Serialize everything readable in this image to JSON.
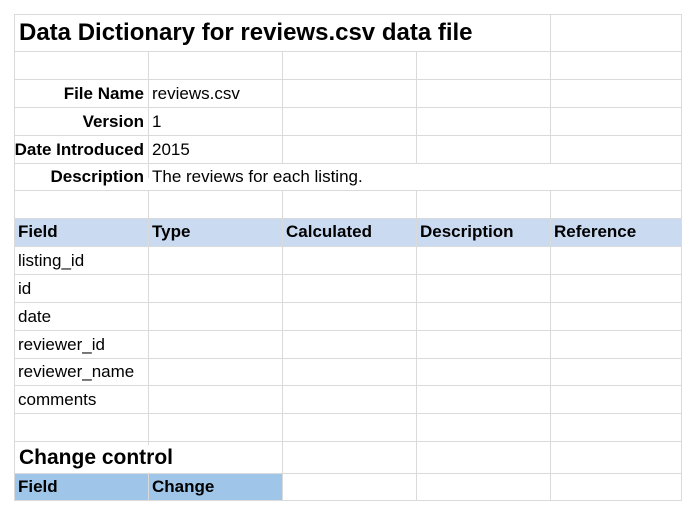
{
  "title": "Data Dictionary for reviews.csv data file",
  "meta": [
    {
      "label": "File Name",
      "value": "reviews.csv"
    },
    {
      "label": "Version",
      "value": "1"
    },
    {
      "label": "Date Introduced",
      "value": "2015"
    },
    {
      "label": "Description",
      "value": "The reviews for each listing."
    }
  ],
  "fields_table": {
    "headers": [
      "Field",
      "Type",
      "Calculated",
      "Description",
      "Reference"
    ],
    "rows": [
      "listing_id",
      "id",
      "date",
      "reviewer_id",
      "reviewer_name",
      "comments"
    ]
  },
  "change_control": {
    "title": "Change control",
    "headers": [
      "Field",
      "Change"
    ]
  },
  "colors": {
    "header_fill": "#c9daf1",
    "change_header_fill": "#9fc5e8",
    "grid": "#dadada"
  }
}
